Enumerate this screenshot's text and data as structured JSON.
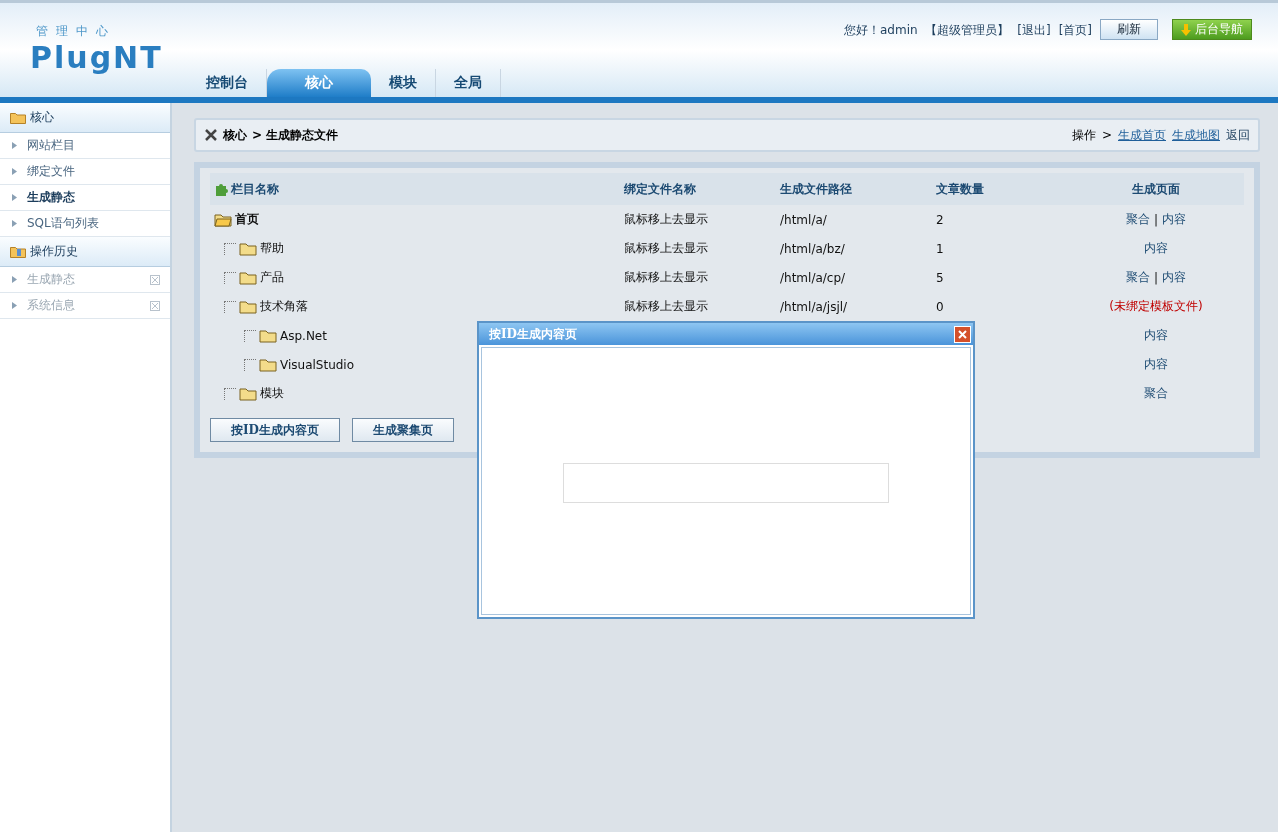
{
  "header": {
    "subtitle": "管理中心",
    "logo": "PlugNT",
    "greeting": "您好！",
    "user": "admin",
    "role": "【超级管理员】",
    "logout": "[退出]",
    "home": "[首页]",
    "refresh_button": "刷新",
    "nav_button": "后台导航"
  },
  "tabs": [
    {
      "label": "控制台",
      "selected": false
    },
    {
      "label": "核心",
      "selected": true
    },
    {
      "label": "模块",
      "selected": false
    },
    {
      "label": "全局",
      "selected": false
    }
  ],
  "sidebar": [
    {
      "title": "核心",
      "kind": "core",
      "items": [
        {
          "label": "网站栏目",
          "selected": false,
          "closable": false
        },
        {
          "label": "绑定文件",
          "selected": false,
          "closable": false
        },
        {
          "label": "生成静态",
          "selected": true,
          "closable": false
        },
        {
          "label": "SQL语句列表",
          "selected": false,
          "closable": false
        }
      ]
    },
    {
      "title": "操作历史",
      "kind": "history",
      "items": [
        {
          "label": "生成静态",
          "selected": false,
          "closable": true
        },
        {
          "label": "系统信息",
          "selected": false,
          "closable": true
        }
      ]
    }
  ],
  "breadcrumb": {
    "section": "核心",
    "page": "> 生成静态文件",
    "ops_label": "操作",
    "ops_sep": ">",
    "links": [
      "生成首页",
      "生成地图"
    ],
    "back": "返回"
  },
  "table": {
    "link_separator": "|",
    "columns": [
      "栏目名称",
      "绑定文件名称",
      "生成文件路径",
      "文章数量",
      "生成页面"
    ],
    "rows": [
      {
        "name": "首页",
        "binding": "鼠标移上去显示",
        "path": "/html/a/",
        "count": "2",
        "pages": [
          "聚合",
          "内容"
        ],
        "expanded": true,
        "children": [
          {
            "name": "帮助",
            "binding": "鼠标移上去显示",
            "path": "/html/a/bz/",
            "count": "1",
            "pages": [
              "内容"
            ],
            "expanded": false
          },
          {
            "name": "产品",
            "binding": "鼠标移上去显示",
            "path": "/html/a/cp/",
            "count": "5",
            "pages": [
              "聚合",
              "内容"
            ],
            "expanded": false
          },
          {
            "name": "技术角落",
            "binding": "鼠标移上去显示",
            "path": "/html/a/jsjl/",
            "count": "0",
            "warning": "(未绑定模板文件)",
            "expanded": false,
            "children": [
              {
                "name": "Asp.Net",
                "pages": [
                  "内容"
                ],
                "expanded": false
              },
              {
                "name": "VisualStudio",
                "pages": [
                  "内容"
                ],
                "expanded": false
              }
            ]
          },
          {
            "name": "模块",
            "pages": [
              "聚合"
            ],
            "expanded": false
          }
        ]
      }
    ]
  },
  "buttons": [
    "按ID生成内容页",
    "生成聚集页"
  ],
  "dialog": {
    "title": "按ID生成内容页"
  }
}
